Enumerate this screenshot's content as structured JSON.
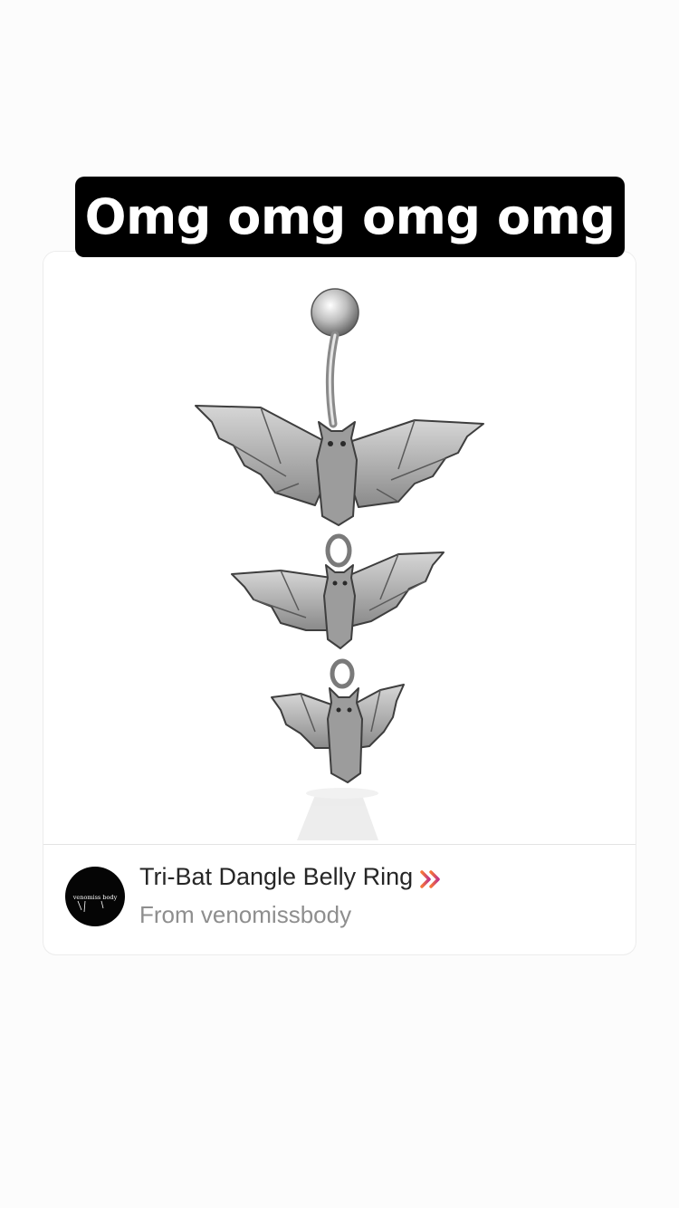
{
  "story": {
    "caption": "Omg omg omg omg"
  },
  "product": {
    "title": "Tri-Bat Dangle Belly Ring",
    "seller": "From venomissbody",
    "avatar_logo_text": "venomiss body",
    "link_icon": "double-chevron-right-icon",
    "image": "bat-belly-ring-photo"
  },
  "colors": {
    "caption_bg": "#000000",
    "caption_text": "#ffffff",
    "background": "#fcfcfc",
    "title_text": "#262626",
    "seller_text": "#8e8e8e",
    "chevron_gradient": [
      "#f77737",
      "#c13584"
    ]
  }
}
